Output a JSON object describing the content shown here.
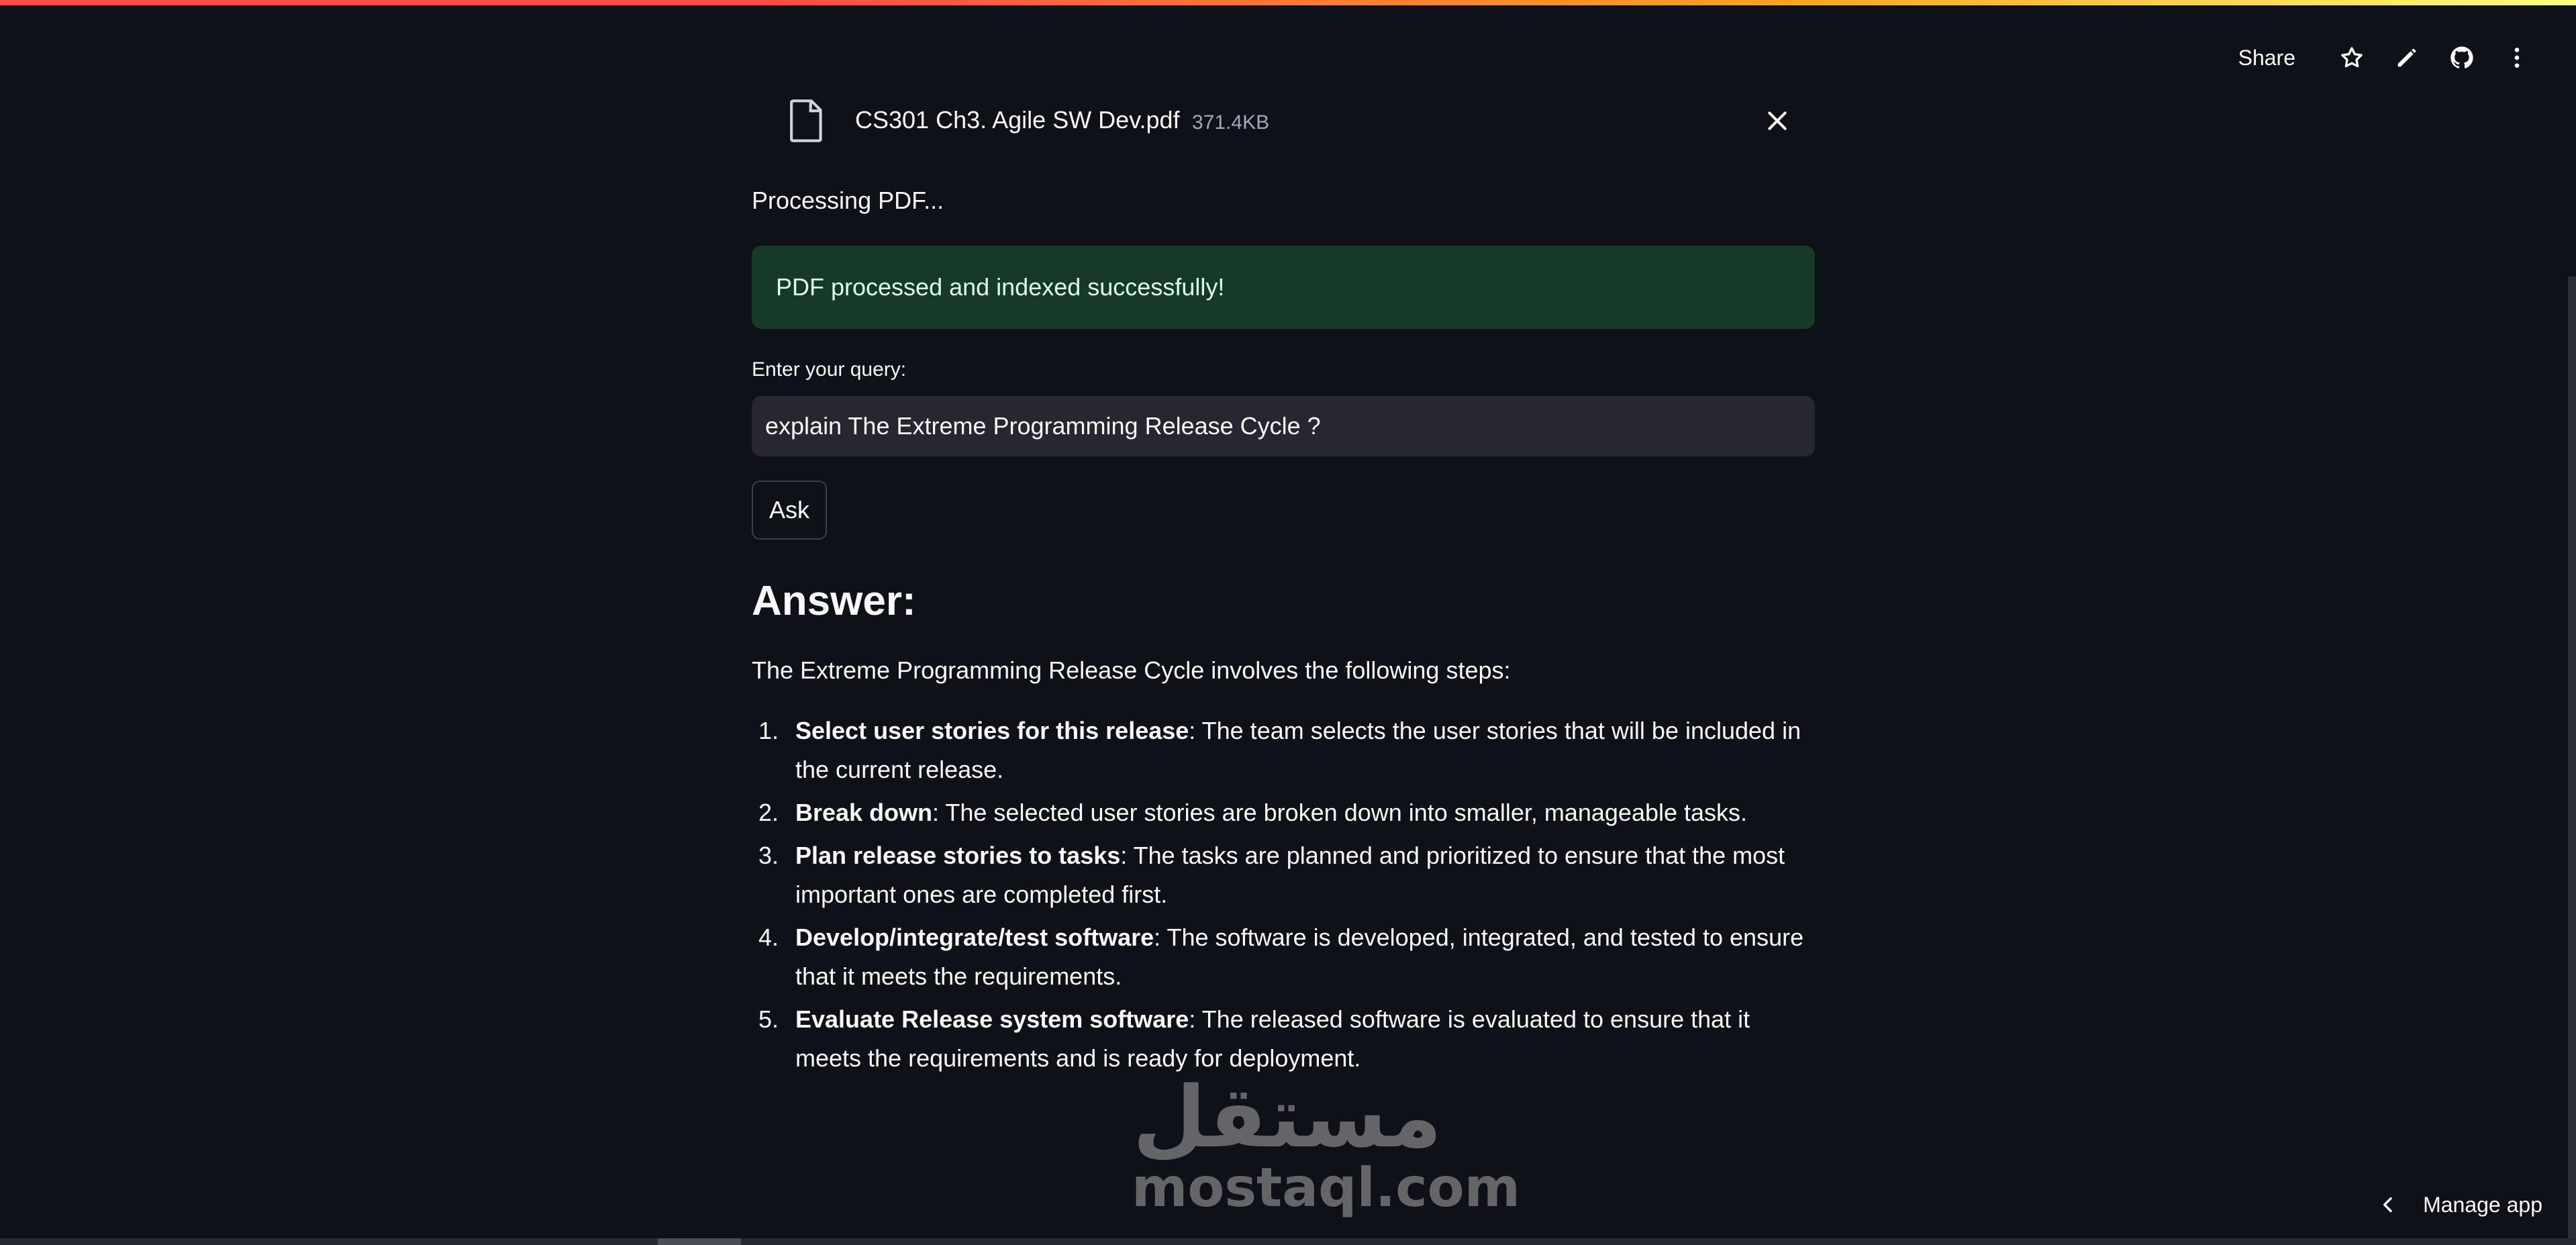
{
  "header": {
    "share_label": "Share",
    "icons": [
      "star-icon",
      "pencil-icon",
      "github-icon",
      "more-vert-icon"
    ]
  },
  "uploader": {
    "file_name": "CS301 Ch3. Agile SW Dev.pdf",
    "file_size": "371.4KB"
  },
  "status": {
    "processing": "Processing PDF...",
    "success": "PDF processed and indexed successfully!"
  },
  "query": {
    "label": "Enter your query:",
    "value": "explain The Extreme Programming Release Cycle ?"
  },
  "ask_button": "Ask",
  "answer": {
    "heading": "Answer:",
    "intro": "The Extreme Programming Release Cycle involves the following steps:",
    "steps": [
      {
        "num": "1.",
        "title": "Select user stories for this release",
        "text": ": The team selects the user stories that will be included in the current release."
      },
      {
        "num": "2.",
        "title": "Break down",
        "text": ": The selected user stories are broken down into smaller, manageable tasks."
      },
      {
        "num": "3.",
        "title": "Plan release stories to tasks",
        "text": ": The tasks are planned and prioritized to ensure that the most important ones are completed first."
      },
      {
        "num": "4.",
        "title": "Develop/integrate/test software",
        "text": ": The software is developed, integrated, and tested to ensure that it meets the requirements."
      },
      {
        "num": "5.",
        "title": "Evaluate Release system software",
        "text": ": The released software is evaluated to ensure that it meets the requirements and is ready for deployment."
      }
    ]
  },
  "watermark": {
    "arabic": "مستقل",
    "latin": "mostaql.com"
  },
  "footer": {
    "manage_app": "Manage app"
  },
  "colors": {
    "background": "#0e1117",
    "success_bg": "#173928",
    "input_bg": "#262730",
    "accent_red": "#ff4b4b"
  }
}
